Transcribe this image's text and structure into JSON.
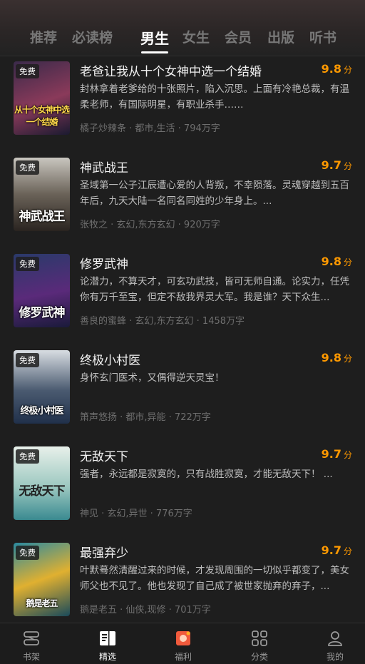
{
  "tabs": [
    {
      "label": "推荐"
    },
    {
      "label": "必读榜"
    },
    {
      "label": "男生"
    },
    {
      "label": "女生"
    },
    {
      "label": "会员"
    },
    {
      "label": "出版"
    },
    {
      "label": "听书"
    }
  ],
  "active_tab": "男生",
  "free_badge": "免费",
  "score_unit": "分",
  "books": [
    {
      "title": "老爸让我从十个女神中选一个结婚",
      "score": "9.8",
      "desc": "封林拿着老爹给的十张照片，陷入沉思。上面有冷艳总裁，有温柔老师，有国际明星，有职业杀手……",
      "meta": "橘子炒辣条 · 都市,生活 · 794万字",
      "cover_text": "从十个女神中选一个结婚",
      "cover_colors": [
        "#3a2a4a",
        "#8a3a5a",
        "#1a1a30"
      ]
    },
    {
      "title": "神武战王",
      "score": "9.7",
      "desc": "圣域第一公子江辰遭心爱的人背叛，不幸陨落。灵魂穿越到五百年后，九天大陆一名同名同姓的少年身上。...",
      "meta": "张牧之 · 玄幻,东方玄幻 · 920万字",
      "cover_text": "神武战王",
      "cover_colors": [
        "#c9c6bf",
        "#6a6258",
        "#2a2420"
      ]
    },
    {
      "title": "修罗武神",
      "score": "9.8",
      "desc": "论潜力，不算天才，可玄功武技，皆可无师自通。论实力，任凭你有万千至宝，但定不敌我界灵大军。我是谁？天下众生...",
      "meta": "善良的蜜蜂 · 玄幻,东方玄幻 · 1458万字",
      "cover_text": "修罗武神",
      "cover_colors": [
        "#2a3a6a",
        "#5a2a7a",
        "#1a1a3a"
      ]
    },
    {
      "title": "终极小村医",
      "score": "9.8",
      "desc": "身怀玄门医术，又偶得逆天灵宝！",
      "meta": "箫声悠扬 · 都市,异能 · 722万字",
      "cover_text": "终极小村医",
      "cover_colors": [
        "#d8dde2",
        "#4a5a70",
        "#20304a"
      ]
    },
    {
      "title": "无敌天下",
      "score": "9.7",
      "desc": "强者，永远都是寂寞的，只有战胜寂寞，才能无敌天下！ ...",
      "meta": "神见 · 玄幻,异世 · 776万字",
      "cover_text": "无敌天下",
      "cover_colors": [
        "#e8f0ea",
        "#9cc8c0",
        "#3a8a90"
      ]
    },
    {
      "title": "最强弃少",
      "score": "9.7",
      "desc": "叶默蓦然清醒过来的时候，才发现周围的一切似乎都变了，美女师父也不见了。他也发现了自己成了被世家抛弃的弃子，...",
      "meta": "鹅是老五 · 仙侠,现修 · 701万字",
      "cover_text": "鹅是老五",
      "cover_colors": [
        "#2a8aa0",
        "#e0b030",
        "#1a4a5a"
      ]
    }
  ],
  "nav": [
    {
      "label": "书架",
      "icon": "bookshelf-icon"
    },
    {
      "label": "精选",
      "icon": "featured-book-icon"
    },
    {
      "label": "福利",
      "icon": "gift-icon"
    },
    {
      "label": "分类",
      "icon": "grid-category-icon"
    },
    {
      "label": "我的",
      "icon": "user-icon"
    }
  ],
  "colors": {
    "accent": "#ff9900",
    "welfare": "#f05a3c"
  }
}
